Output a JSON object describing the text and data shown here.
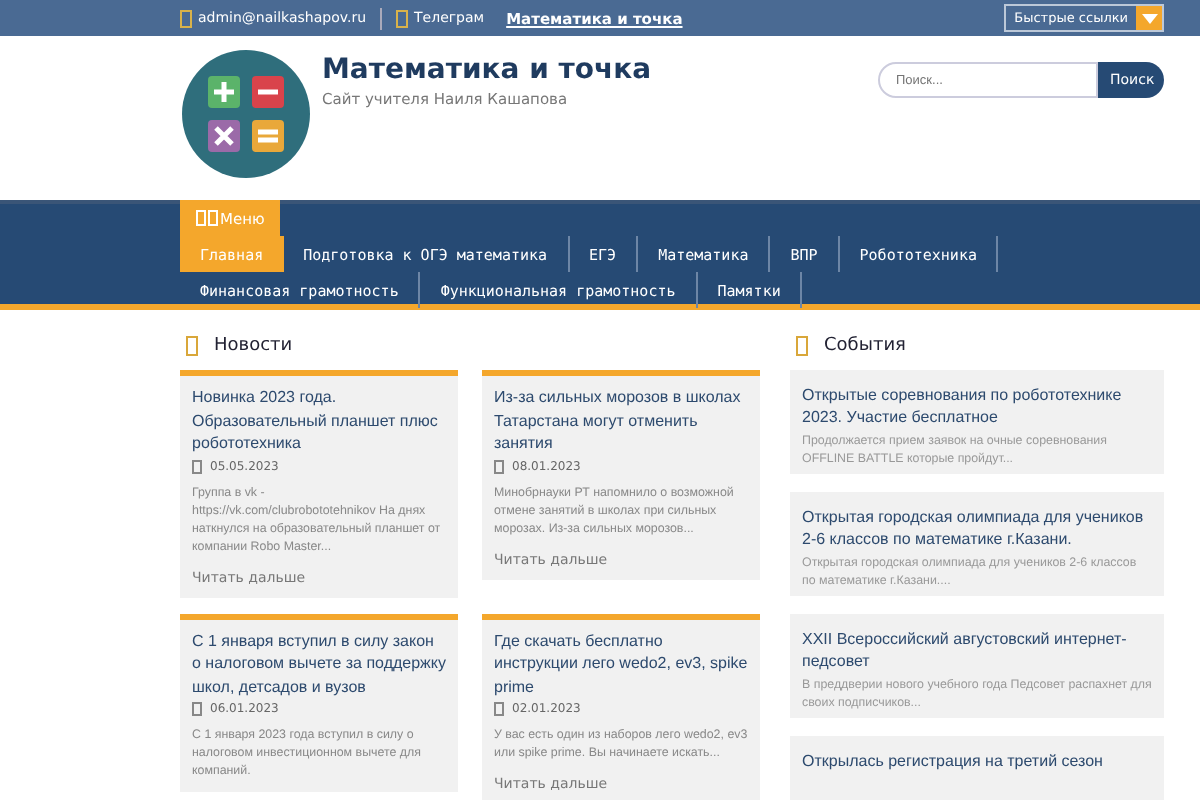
{
  "top_bar": {
    "email": "admin@nailkashapov.ru",
    "telegram": "Телеграм",
    "site_link": "Математика и точка",
    "quick_links": "Быстрые ссылки"
  },
  "header": {
    "title": "Математика и точка",
    "subtitle": "Сайт учителя Наиля Кашапова",
    "search": {
      "placeholder": "Поиск...",
      "button": "Поиск"
    }
  },
  "nav": {
    "menu_button": "Меню",
    "items": [
      {
        "label": "Главная",
        "selected": true
      },
      {
        "label": "Подготовка к ОГЭ математика",
        "selected": false
      },
      {
        "label": "ЕГЭ",
        "selected": false
      },
      {
        "label": "Математика",
        "selected": false
      },
      {
        "label": "ВПР",
        "selected": false
      },
      {
        "label": "Робототехника",
        "selected": false
      },
      {
        "label": "Финансовая грамотность",
        "selected": false
      },
      {
        "label": "Функциональная грамотность",
        "selected": false
      },
      {
        "label": "Памятки",
        "selected": false
      }
    ]
  },
  "news": {
    "heading": "Новости",
    "cards": [
      {
        "title": "Новинка 2023 года. Образовательный планшет плюс робототехника",
        "date": "05.05.2023",
        "excerpt": "Группа в vk - https://vk.com/clubrobototehnikov На днях наткнулся на образовательный планшет от компании Robo Master...",
        "read_more": "Читать дальше"
      },
      {
        "title": "Из-за сильных морозов в школах Татарстана могут отменить занятия",
        "date": "08.01.2023",
        "excerpt": "Минобрнауки РТ напомнило о возможной отмене занятий в школах при сильных морозах. Из-за сильных морозов...",
        "read_more": "Читать дальше"
      },
      {
        "title": "С 1 января вступил в силу закон о налоговом вычете за поддержку школ, детсадов и вузов",
        "date": "06.01.2023",
        "excerpt": "С 1 января 2023 года вступил в силу о налоговом инвестиционном вычете для компаний."
      },
      {
        "title": "Где скачать бесплатно инструкции лего wedo2, ev3, spike prime",
        "date": "02.01.2023",
        "excerpt": "У вас есть один из наборов лего wedo2, ev3 или spike prime. Вы начинаете искать...",
        "read_more": "Читать дальше"
      }
    ]
  },
  "events": {
    "heading": "События",
    "items": [
      {
        "title": "Открытые соревнования по робототехнике 2023. Участие бесплатное",
        "excerpt": "Продолжается прием заявок на очные соревнования OFFLINE BATTLE которые пройдут..."
      },
      {
        "title": "Открытая городская олимпиада для учеников 2-6 классов по математике г.Казани.",
        "excerpt": "Открытая городская олимпиада для учеников 2-6 классов по математике г.Казани...."
      },
      {
        "title": "XXII Всероссийский августовский интернет-педсовет",
        "excerpt": " В преддверии нового учебного года Педсовет распахнет для своих подписчиков..."
      },
      {
        "title": "Открылась регистрация на третий сезон"
      }
    ]
  }
}
